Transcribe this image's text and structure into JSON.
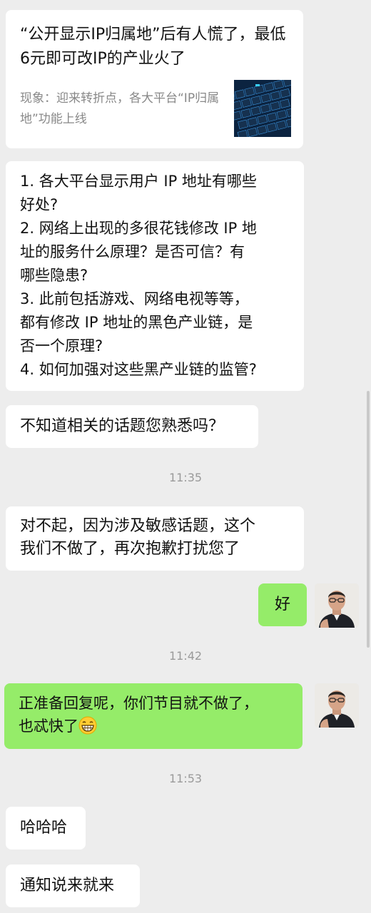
{
  "link_card": {
    "title": "“公开显示IP归属地”后有人慌了，最低6元即可改IP的产业火了",
    "description": "现象：迎来转折点，各大平台“IP归属地”功能上线",
    "thumbnail_icon": "keyboard-photo-icon"
  },
  "messages": {
    "questions": {
      "lines": [
        "1. 各大平台显示用户 IP 地址有哪些",
        "好处?",
        "2. 网络上出现的多很花钱修改 IP 地",
        "址的服务什么原理？是否可信？有",
        "哪些隐患?",
        "3. 此前包括游戏、网络电视等等，",
        "都有修改 IP 地址的黑色产业链，是",
        "否一个原理?",
        "4. 如何加强对这些黑产业链的监管?"
      ]
    },
    "familiar": "不知道相关的话题您熟悉吗？",
    "time1": "11:35",
    "sorry_line1": "对不起，因为涉及敏感话题，这个",
    "sorry_line2": "我们不做了，再次抱歉打扰您了",
    "ok": "好",
    "time2": "11:42",
    "reply_line1": "正准备回复呢，你们节目就不做了，",
    "reply_line2": "也忒快了",
    "reply_emoji": "grinning-face-icon",
    "time3": "11:53",
    "haha": "哈哈哈",
    "notice": "通知说来就来"
  },
  "colors": {
    "background": "#ededed",
    "incoming_bubble": "#ffffff",
    "outgoing_bubble": "#95ec69",
    "timestamp": "#9a9a9a"
  }
}
